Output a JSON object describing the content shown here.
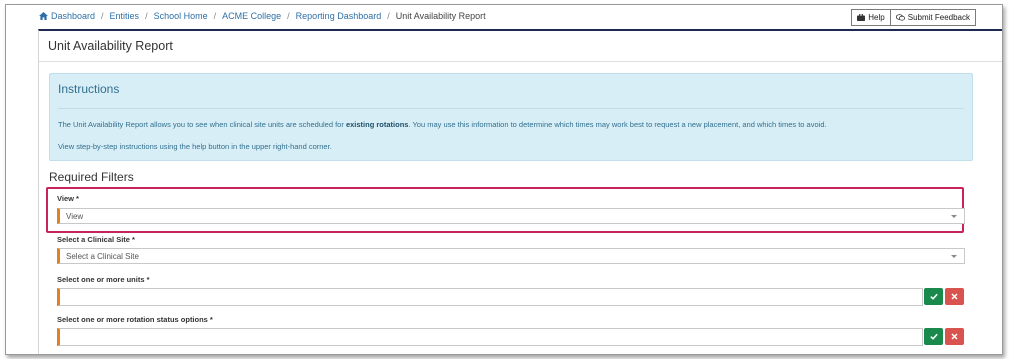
{
  "breadcrumb": {
    "items": [
      "Dashboard",
      "Entities",
      "School Home",
      "ACME College",
      "Reporting Dashboard"
    ],
    "current": "Unit Availability Report",
    "separator": "/"
  },
  "toolbar": {
    "help_label": "Help",
    "feedback_label": "Submit Feedback"
  },
  "page": {
    "title": "Unit Availability Report"
  },
  "instructions": {
    "title": "Instructions",
    "p1_before": "The Unit Availability Report allows you to see when clinical site units are scheduled for ",
    "p1_bold": "existing rotations",
    "p1_after": ". You may use this information to determine which times may work best to request a new placement, and which times to avoid.",
    "p2": "View step-by-step instructions using the help button in the upper right-hand corner."
  },
  "filters": {
    "section_title": "Required Filters",
    "view": {
      "label": "View *",
      "value": "View"
    },
    "clinical_site": {
      "label": "Select a Clinical Site *",
      "value": "Select a Clinical Site"
    },
    "units": {
      "label": "Select one or more units *",
      "value": ""
    },
    "rotation_status": {
      "label": "Select one or more rotation status options *",
      "value": ""
    }
  },
  "icons": {
    "confirm": "check-icon",
    "clear": "x-icon",
    "home": "home-icon"
  },
  "colors": {
    "accent_orange": "#e67e22",
    "highlight": "#c8245a",
    "confirm": "#1a8a4c",
    "clear": "#d9534f",
    "info_bg": "#d8eef6"
  }
}
